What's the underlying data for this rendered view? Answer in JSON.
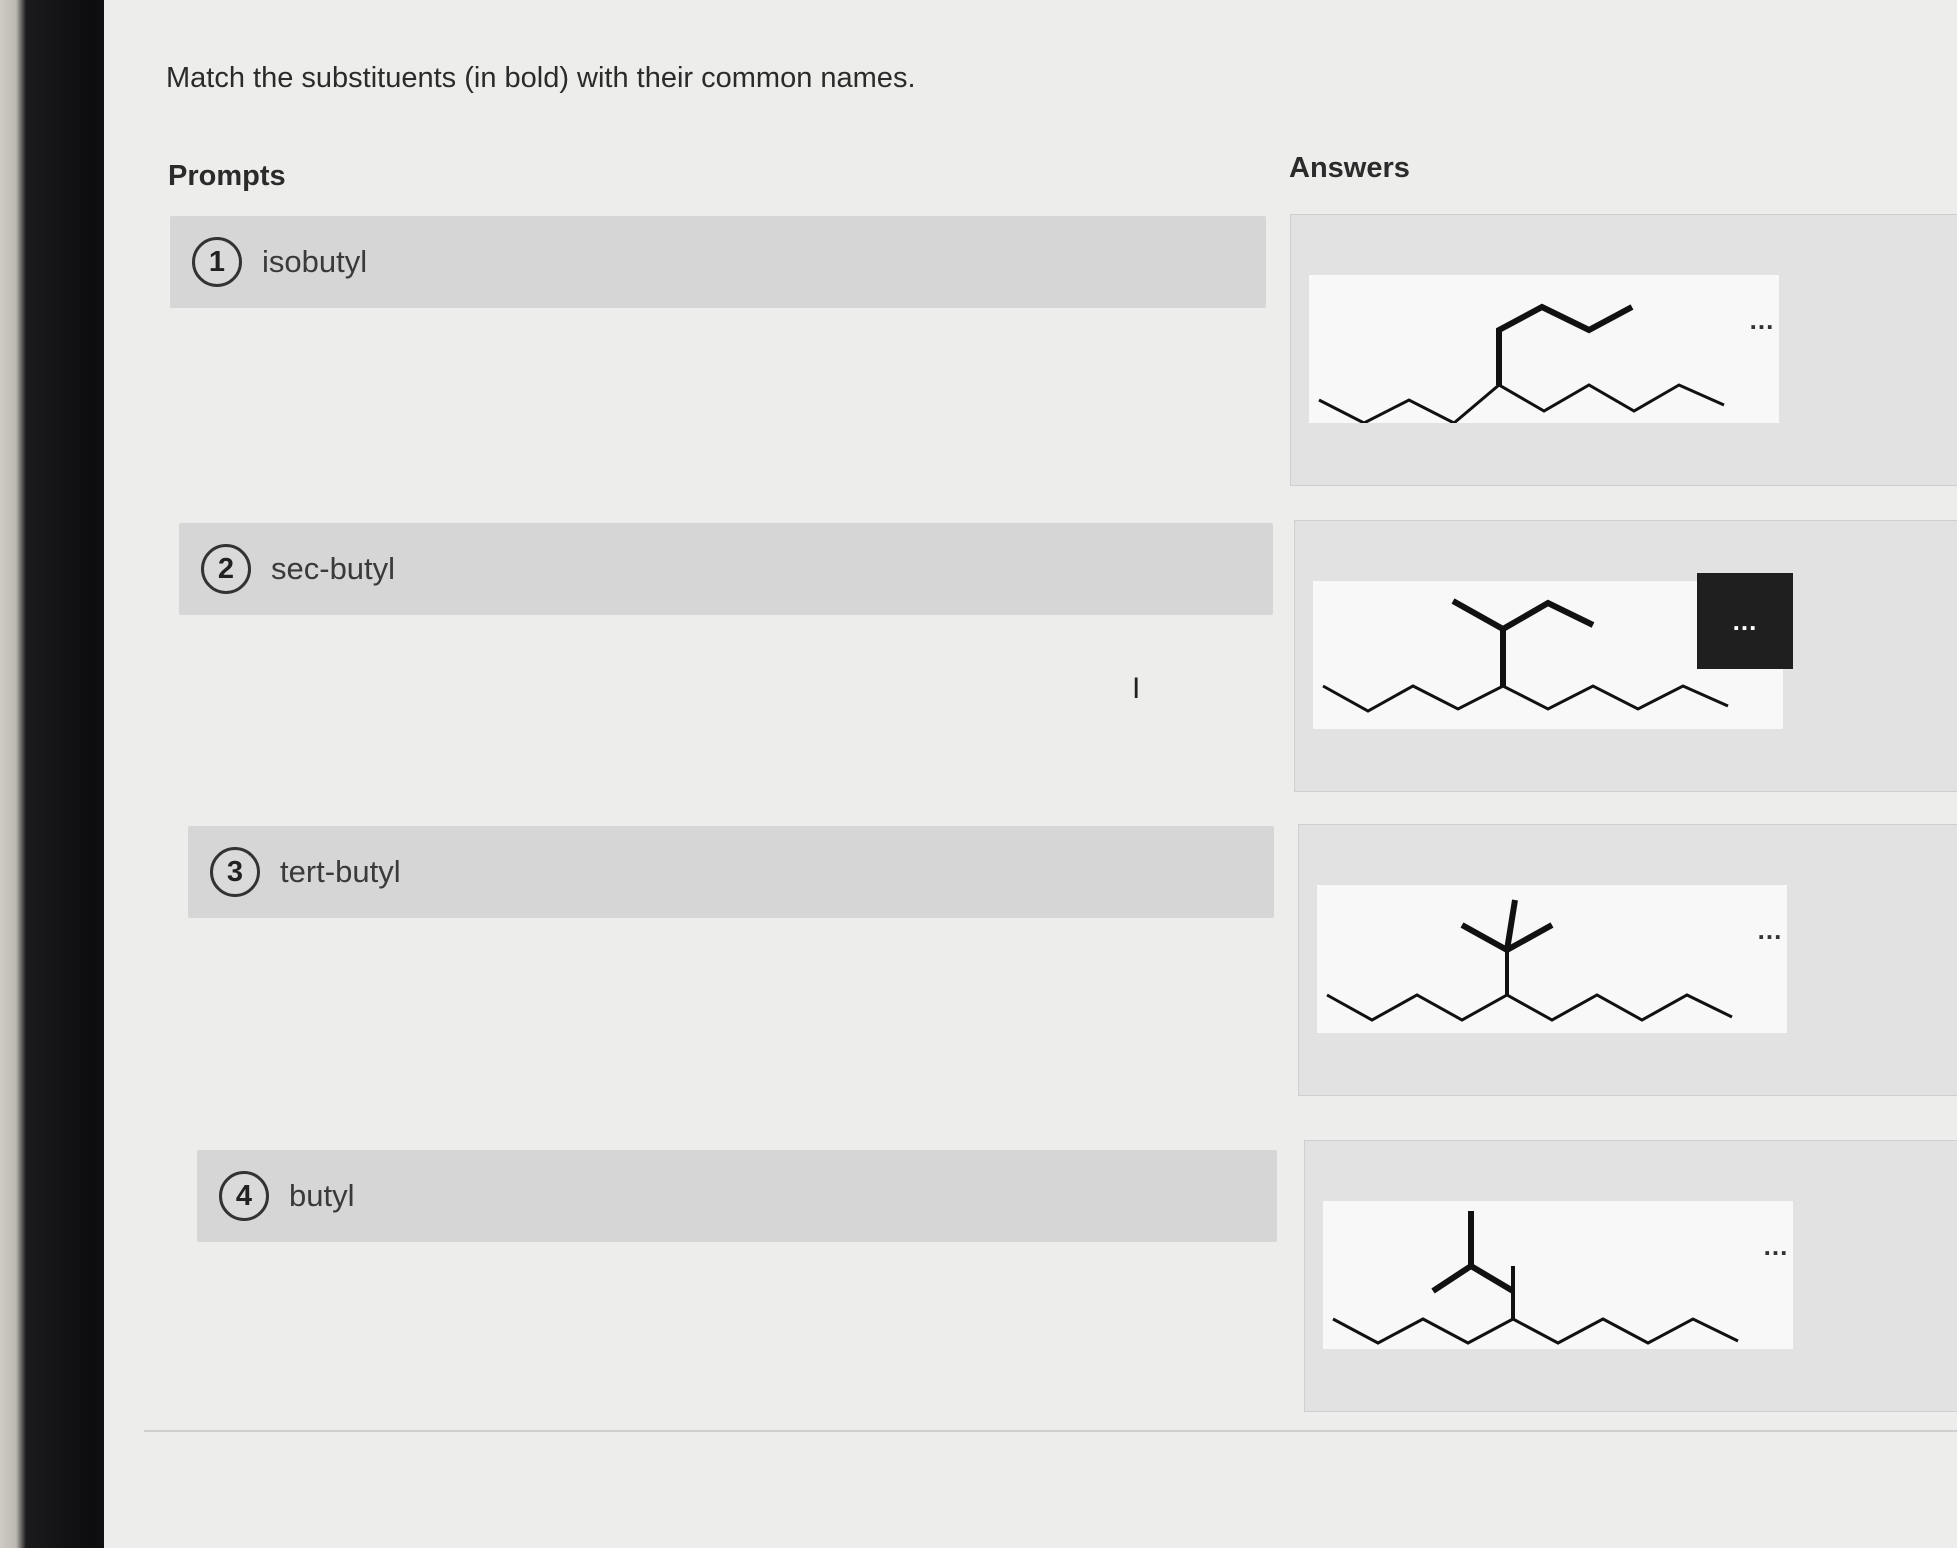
{
  "instruction": "Match the substituents (in bold) with their common names.",
  "prompts_title": "Prompts",
  "answers_title": "Answers",
  "prompts": [
    {
      "number": "1",
      "label": "isobutyl"
    },
    {
      "number": "2",
      "label": "sec-butyl"
    },
    {
      "number": "3",
      "label": "tert-butyl"
    },
    {
      "number": "4",
      "label": "butyl"
    }
  ],
  "answers": [
    {
      "structure": "butyl-branch-structure",
      "more_label": "..."
    },
    {
      "structure": "sec-butyl-branch-structure",
      "more_label": "...",
      "selected": true
    },
    {
      "structure": "tert-butyl-branch-structure",
      "more_label": "..."
    },
    {
      "structure": "isobutyl-branch-structure",
      "more_label": "..."
    }
  ],
  "colors": {
    "screen": "#ededeb",
    "card": "#d6d6d6",
    "selected_button": "#1f1f1f"
  }
}
